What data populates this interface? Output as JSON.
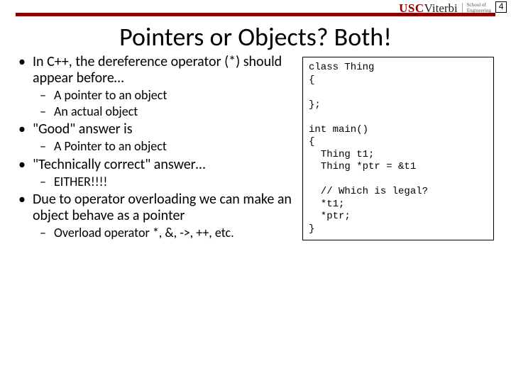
{
  "pageNumber": "4",
  "branding": {
    "usc": "USC",
    "viterbi": "Viterbi",
    "schoolLine1": "School of",
    "schoolLine2": "Engineering"
  },
  "title": "Pointers or Objects? Both!",
  "bullets": {
    "b1": "In C++, the dereference operator (*) should appear before…",
    "b1s1": "A pointer to an object",
    "b1s2": "An actual object",
    "b2": "\"Good\" answer is",
    "b2s1": "A Pointer to an object",
    "b3": "\"Technically correct\" answer…",
    "b3s1": "EITHER!!!!",
    "b4": "Due to operator overloading we can make an object behave as a pointer",
    "b4s1": "Overload operator *, &, ->, ++, etc."
  },
  "code": "class Thing\n{\n\n};\n\nint main()\n{\n  Thing t1;\n  Thing *ptr = &t1\n\n  // Which is legal?\n  *t1;\n  *ptr;\n}"
}
